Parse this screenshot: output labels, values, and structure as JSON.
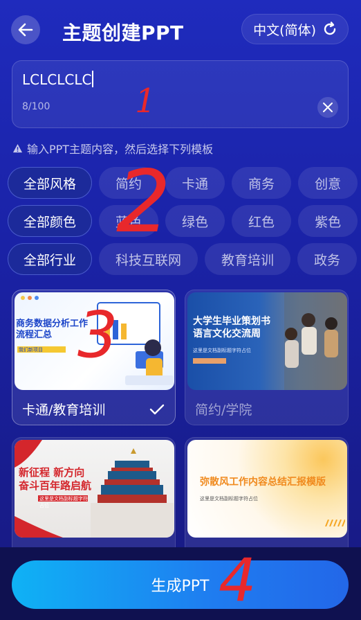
{
  "header": {
    "title": "主题创建PPT",
    "language": "中文(简体)"
  },
  "topic_input": {
    "value": "LCLCLCLC",
    "char_count": "8/100"
  },
  "hint": "输入PPT主题内容，然后选择下列模板",
  "filters": {
    "style": [
      "全部风格",
      "简约",
      "卡通",
      "商务",
      "创意"
    ],
    "color": [
      "全部颜色",
      "蓝色",
      "绿色",
      "红色",
      "紫色"
    ],
    "industry": [
      "全部行业",
      "科技互联网",
      "教育培训",
      "政务"
    ]
  },
  "templates": [
    {
      "label": "卡通/教育培训",
      "selected": true,
      "thumb_title": "商务数据分析工作\n流程汇总",
      "thumb_sub": "我们新项目"
    },
    {
      "label": "简约/学院",
      "selected": false,
      "thumb_title": "大学生毕业策划书\n语言文化交流周",
      "thumb_sub": "这里是文档副标题字符占位"
    },
    {
      "label": "",
      "selected": false,
      "thumb_title": "新征程 新方向\n奋斗百年路启航",
      "thumb_sub": "这里是文档副标题字符占位"
    },
    {
      "label": "",
      "selected": false,
      "thumb_title": "弥散风工作内容总结汇报模版",
      "thumb_sub": "这里是文档副标题字符占位"
    }
  ],
  "generate_button": "生成PPT",
  "annotations": [
    "1",
    "2",
    "3",
    "4"
  ],
  "colors": {
    "accent": "#1f7cf0",
    "annotation": "#e8282b",
    "background": "#1f2bbd"
  }
}
